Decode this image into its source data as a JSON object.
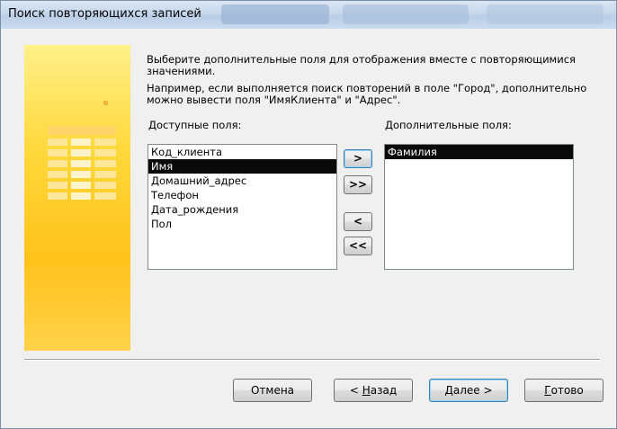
{
  "window": {
    "title": "Поиск повторяющихся записей"
  },
  "instructions": {
    "line1": "Выберите дополнительные поля для отображения вместе с повторяющимися",
    "line2": "значениями.",
    "line3": "Например, если выполняется поиск повторений в поле \"Город\", дополнительно",
    "line4": "можно вывести поля \"ИмяКлиента\" и \"Адрес\"."
  },
  "available": {
    "label": "Доступные поля:",
    "items": [
      "Код_клиента",
      "Имя",
      "Домашний_адрес",
      "Телефон",
      "Дата_рождения",
      "Пол"
    ],
    "selected_index": 1
  },
  "additional": {
    "label": "Дополнительные поля:",
    "items": [
      "Фамилия"
    ],
    "selected_index": 0
  },
  "move_buttons": {
    "add_one": ">",
    "add_all": ">>",
    "remove_one": "<",
    "remove_all": "<<"
  },
  "footer_buttons": {
    "cancel": "Отмена",
    "back_prefix": "< ",
    "back_hotkey": "Н",
    "back_rest": "азад",
    "next_hotkey": "Д",
    "next_rest": "алее >",
    "finish_hotkey": "Г",
    "finish_rest": "отово"
  }
}
